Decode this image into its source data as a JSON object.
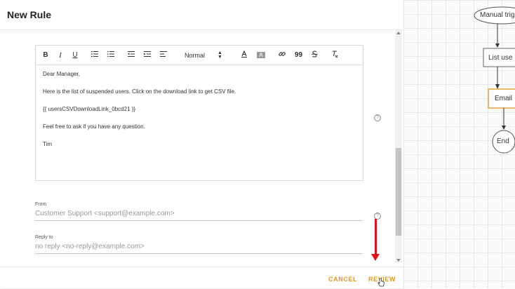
{
  "dialog": {
    "title": "New Rule"
  },
  "editor": {
    "toolbar": {
      "bold": "B",
      "italic": "I",
      "underline": "U",
      "format_select": "Normal",
      "quote": "99",
      "icons": [
        "bold-icon",
        "italic-icon",
        "underline-icon",
        "ordered-list-icon",
        "bullet-list-icon",
        "outdent-icon",
        "indent-icon",
        "align-icon",
        "font-color-icon",
        "background-color-icon",
        "link-icon",
        "quote-icon",
        "strike-icon",
        "clear-format-icon"
      ]
    },
    "body": [
      "Dear Manager,",
      "Here is the list of suspended users. Click on the download link to get CSV file.",
      "{{ usersCSVDownloadLink_0bcd21 }}",
      "Feel free to ask if you have any question.",
      "Tim"
    ]
  },
  "from": {
    "label": "From",
    "value": "Customer Support <support@example.com>"
  },
  "reply_to": {
    "label": "Reply to",
    "value": "no reply <no-reply@example.com>"
  },
  "footer": {
    "cancel_label": "CANCEL",
    "review_label": "REVIEW"
  },
  "flow": {
    "nodes": [
      "Manual trig",
      "List use",
      "Email",
      "End"
    ],
    "email_border_color": "#e0a030",
    "annotation_color": "#e01010",
    "accent_color": "#e09a1a"
  }
}
